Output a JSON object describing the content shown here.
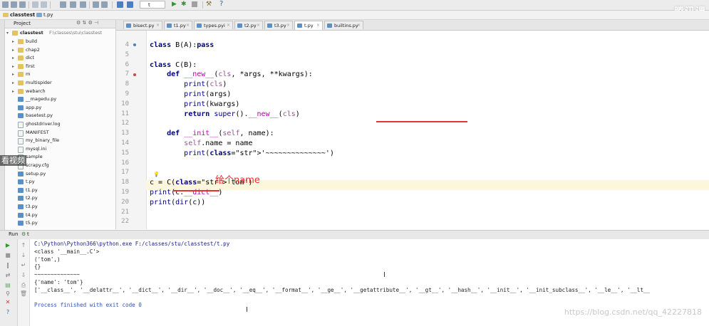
{
  "toolbar": {
    "project_name": "classtest",
    "current_file": "t.py",
    "run_config": "t",
    "help_icon": "?",
    "brand": "腾讯课"
  },
  "project_panel": {
    "title": "Project",
    "root_name": "classtest",
    "root_path": "F:\\classes\\stu\\classtest",
    "items": [
      {
        "label": "build",
        "type": "folder"
      },
      {
        "label": "chap2",
        "type": "folder"
      },
      {
        "label": "dict",
        "type": "folder"
      },
      {
        "label": "first",
        "type": "folder"
      },
      {
        "label": "m",
        "type": "folder"
      },
      {
        "label": "multispider",
        "type": "folder"
      },
      {
        "label": "webarch",
        "type": "folder"
      },
      {
        "label": "__magedu.py",
        "type": "py"
      },
      {
        "label": "app.py",
        "type": "py"
      },
      {
        "label": "basetest.py",
        "type": "py"
      },
      {
        "label": "ghostdriver.log",
        "type": "file"
      },
      {
        "label": "MANIFEST",
        "type": "file"
      },
      {
        "label": "my_binary_file",
        "type": "file"
      },
      {
        "label": "mysql.ini",
        "type": "file"
      },
      {
        "label": "sample",
        "type": "file"
      },
      {
        "label": "scrapy.cfg",
        "type": "file"
      },
      {
        "label": "setup.py",
        "type": "py"
      },
      {
        "label": "t.py",
        "type": "py"
      },
      {
        "label": "t1.py",
        "type": "py"
      },
      {
        "label": "t2.py",
        "type": "py"
      },
      {
        "label": "t3.py",
        "type": "py"
      },
      {
        "label": "t4.py",
        "type": "py"
      },
      {
        "label": "t5.py",
        "type": "py"
      }
    ]
  },
  "tabs": [
    {
      "label": "bisect.py",
      "active": false
    },
    {
      "label": "t1.py",
      "active": false
    },
    {
      "label": "types.pyi",
      "active": false
    },
    {
      "label": "t2.py",
      "active": false
    },
    {
      "label": "t3.py",
      "active": false
    },
    {
      "label": "t.py",
      "active": true
    },
    {
      "label": "builtins.py",
      "active": false
    }
  ],
  "editor": {
    "line_numbers": [
      "4",
      "5",
      "6",
      "7",
      "8",
      "9",
      "10",
      "11",
      "12",
      "13",
      "14",
      "15",
      "16",
      "17",
      "18",
      "19",
      "20",
      "21",
      "22"
    ],
    "lines": {
      "l4": "class B(A):pass",
      "l6": "class C(B):",
      "l7": "    def __new__(cls, *args, **kwargs):",
      "l8": "        print(cls)",
      "l9": "        print(args)",
      "l10": "        print(kwargs)",
      "l11": "        return super().__new__(cls)",
      "l13": "    def __init__(self, name):",
      "l14": "        self.name = name",
      "l15": "        print('~~~~~~~~~~~~~~')",
      "l18": "c = C('tom')",
      "l19": "print(c.__dict__)",
      "l20": "print(dir(c))"
    },
    "annotation": "给个name",
    "overlay_watermark": "看视频"
  },
  "run_panel": {
    "title": "Run",
    "config": "t",
    "output": [
      "C:\\Python\\Python366\\python.exe F:/classes/stu/classtest/t.py",
      "<class '__main__.C'>",
      "('tom',)",
      "{}",
      "~~~~~~~~~~~~~~",
      "{'name': 'tom'}",
      "['__class__', '__delattr__', '__dict__', '__dir__', '__doc__', '__eq__', '__format__', '__ge__', '__getattribute__', '__gt__', '__hash__', '__init__', '__init_subclass__', '__le__', '__lt__",
      "",
      "Process finished with exit code 0"
    ]
  },
  "csdn_watermark": "https://blog.csdn.net/qq_42227818"
}
